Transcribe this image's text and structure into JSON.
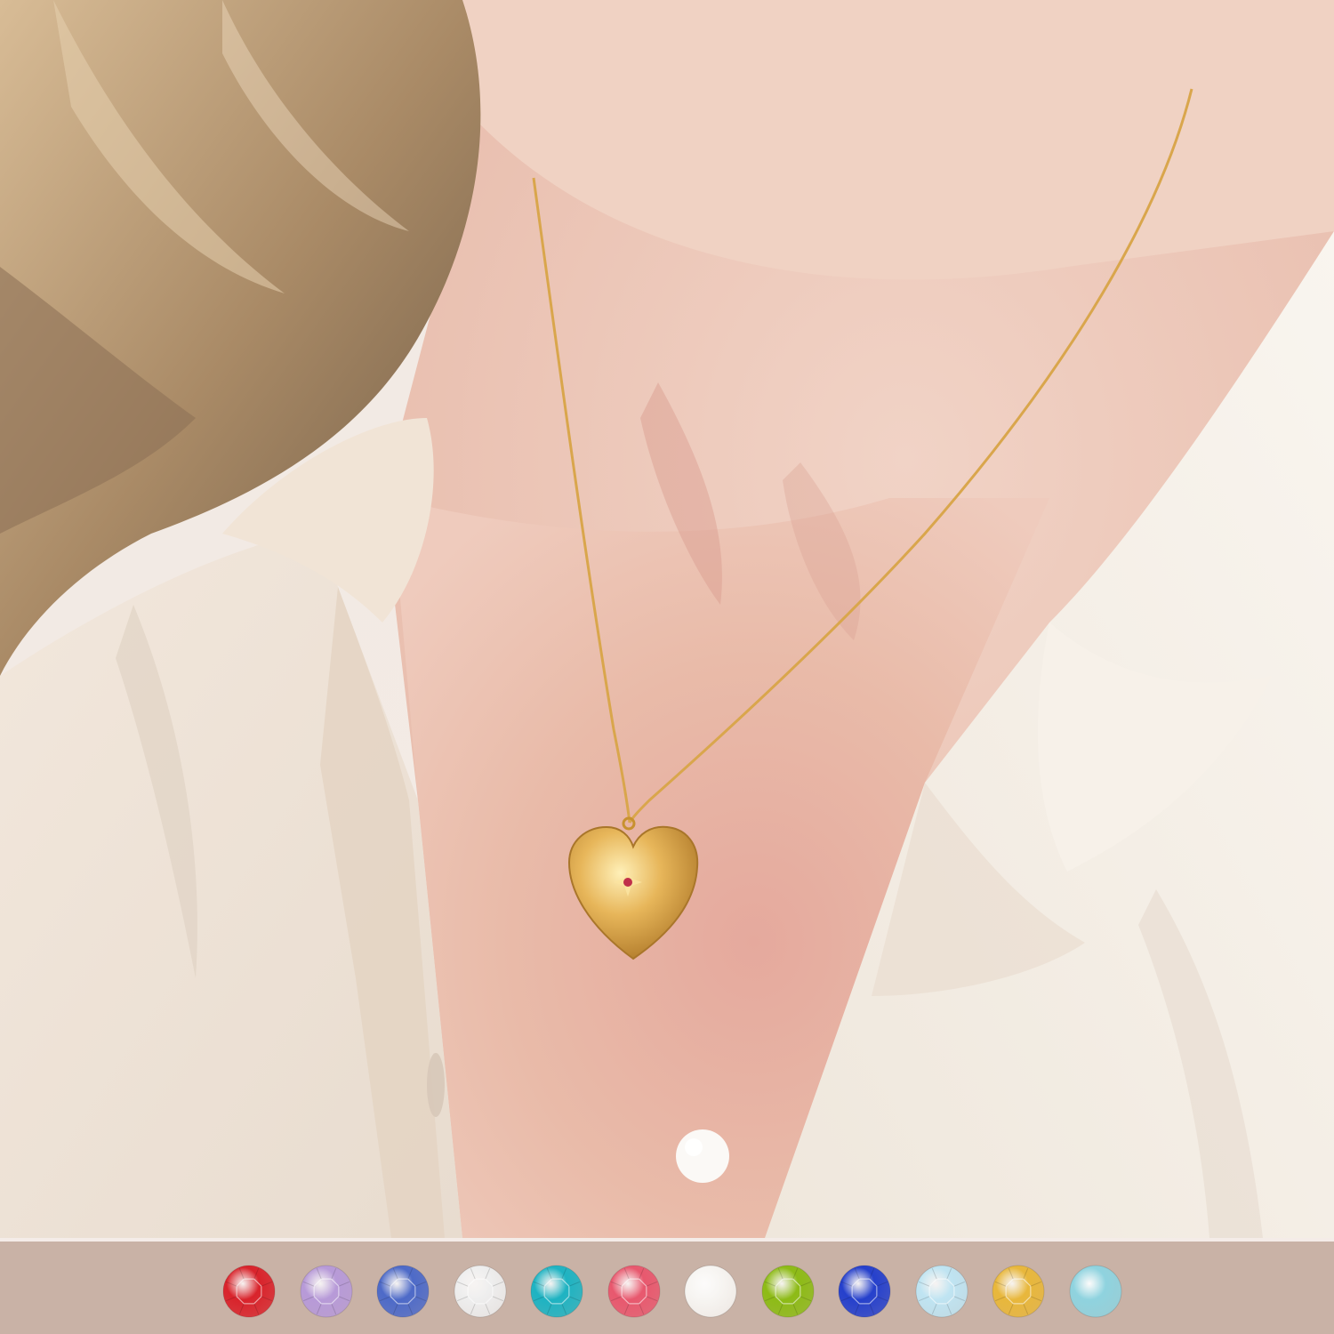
{
  "scene": {
    "subject": "gold-heart-locket-necklace",
    "palette": {
      "skin": "#e9b8aa",
      "shirt": "#f3ece3",
      "hair": "#b99a78",
      "gold": "#d8a645",
      "strip": "#c9b2a6"
    }
  },
  "swatches": [
    {
      "name": "ruby-red",
      "color": "#d9232b",
      "kind": "crystal"
    },
    {
      "name": "lavender",
      "color": "#b79ad8",
      "kind": "crystal"
    },
    {
      "name": "sapphire-blue",
      "color": "#4d6ac8",
      "kind": "crystal"
    },
    {
      "name": "clear",
      "color": "#eeeeee",
      "kind": "crystal"
    },
    {
      "name": "aquamarine-teal",
      "color": "#1eb3c2",
      "kind": "crystal"
    },
    {
      "name": "rose-pink",
      "color": "#e8586e",
      "kind": "crystal"
    },
    {
      "name": "pearl-white",
      "color": "#f7f5f2",
      "kind": "pearl"
    },
    {
      "name": "peridot-green",
      "color": "#8dbb16",
      "kind": "crystal"
    },
    {
      "name": "royal-blue",
      "color": "#2540cc",
      "kind": "crystal"
    },
    {
      "name": "aurora-borealis",
      "color": "#bfe4f2",
      "kind": "crystal"
    },
    {
      "name": "topaz-yellow",
      "color": "#e8b73b",
      "kind": "crystal"
    },
    {
      "name": "turquoise",
      "color": "#8fd3df",
      "kind": "turquoise"
    }
  ]
}
